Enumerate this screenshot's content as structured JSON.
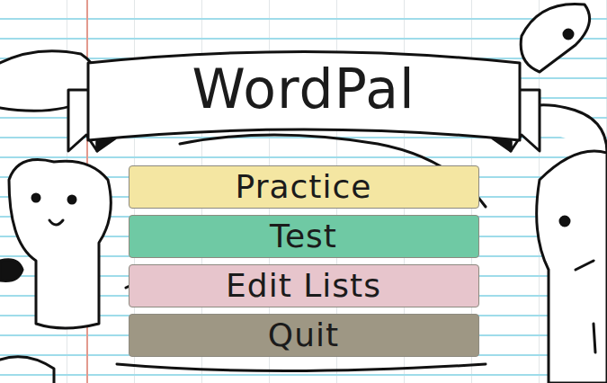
{
  "title": "WordPal",
  "menu": [
    {
      "label": "Practice",
      "color": "#f4e6a2"
    },
    {
      "label": "Test",
      "color": "#6fc9a4"
    },
    {
      "label": "Edit Lists",
      "color": "#e7c5cc"
    },
    {
      "label": "Quit",
      "color": "#9e9784"
    }
  ]
}
